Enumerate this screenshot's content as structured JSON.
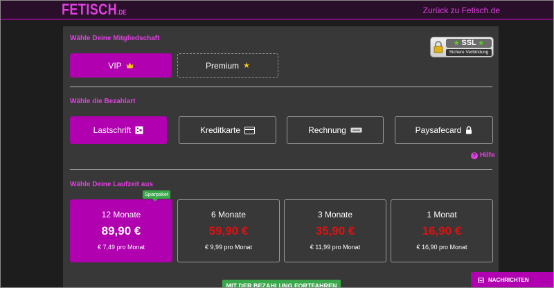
{
  "header": {
    "logo_main": "FETISCH",
    "logo_tld": ".DE",
    "back_link": "Zurück zu Fetisch.de"
  },
  "membership": {
    "title": "Wähle Deine Mitgliedschaft",
    "options": [
      {
        "label": "VIP",
        "icon": "crown-icon",
        "active": true
      },
      {
        "label": "Premium",
        "icon": "star-icon",
        "active": false
      }
    ]
  },
  "ssl_badge": {
    "title": "SSL",
    "subtitle": "Sichere Verbindung"
  },
  "payment": {
    "title": "Wähle die Bezahlart",
    "options": [
      {
        "label": "Lastschrift",
        "icon": "bank-card-icon",
        "active": true
      },
      {
        "label": "Kreditkarte",
        "icon": "credit-card-icon",
        "active": false
      },
      {
        "label": "Rechnung",
        "icon": "invoice-icon",
        "active": false
      },
      {
        "label": "Paysafecard",
        "icon": "lock-icon",
        "active": false
      }
    ],
    "help_label": "Hilfe"
  },
  "duration": {
    "title": "Wähle Deine Laufzeit aus",
    "badge": "Sparpaket",
    "plans": [
      {
        "duration": "12 Monate",
        "price": "89,90 €",
        "monthly": "€ 7,49 pro Monat",
        "active": true
      },
      {
        "duration": "6 Monate",
        "price": "59,90 €",
        "monthly": "€ 9,99 pro Monat",
        "active": false
      },
      {
        "duration": "3 Monate",
        "price": "35,90 €",
        "monthly": "€ 11,99 pro Monat",
        "active": false
      },
      {
        "duration": "1 Monat",
        "price": "16,90 €",
        "monthly": "€ 16,90 pro Monat",
        "active": false
      }
    ]
  },
  "continue_button": "MIT DER BEZAHLUNG FORTFAHREN",
  "messages_button": "NACHRICHTEN",
  "colors": {
    "accent": "#b000b0",
    "brand_pink": "#e23fe2",
    "price_red": "#e01010",
    "green": "#3aa84a"
  }
}
